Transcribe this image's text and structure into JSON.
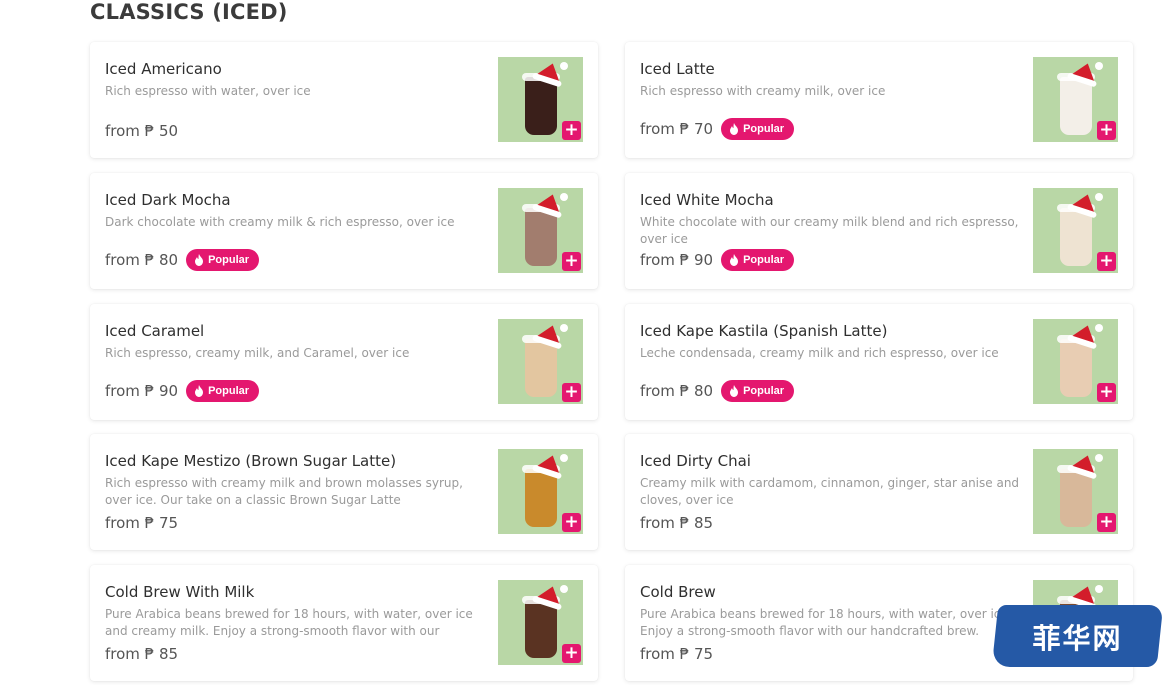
{
  "section": {
    "title": "CLASSICS (ICED)"
  },
  "popular_label": "Popular",
  "colors": {
    "accent": "#e4176f",
    "thumb_bg": "#b9d7a6"
  },
  "products": [
    {
      "name": "Iced Americano",
      "desc": "Rich espresso with water, over ice",
      "price": "from ₱ 50",
      "popular": false,
      "cup": "#3a1f1a"
    },
    {
      "name": "Iced Latte",
      "desc": "Rich espresso with creamy milk, over ice",
      "price": "from ₱ 70",
      "popular": true,
      "cup": "#f3efe8"
    },
    {
      "name": "Iced Dark Mocha",
      "desc": "Dark chocolate with creamy milk & rich espresso, over ice",
      "price": "from ₱ 80",
      "popular": true,
      "cup": "#a27d6e"
    },
    {
      "name": "Iced White Mocha",
      "desc": "White chocolate with our creamy milk blend and rich espresso, over ice",
      "price": "from ₱ 90",
      "popular": true,
      "cup": "#eee3d2"
    },
    {
      "name": "Iced Caramel",
      "desc": "Rich espresso, creamy milk, and Caramel, over ice",
      "price": "from ₱ 90",
      "popular": true,
      "cup": "#e3c6a0"
    },
    {
      "name": "Iced Kape Kastila (Spanish Latte)",
      "desc": "Leche condensada, creamy milk and rich espresso, over ice",
      "price": "from ₱ 80",
      "popular": true,
      "cup": "#e8cdb3"
    },
    {
      "name": "Iced Kape Mestizo (Brown Sugar Latte)",
      "desc": "Rich espresso with creamy milk and brown molasses syrup, over ice. Our take on a classic Brown Sugar Latte",
      "price": "from ₱ 75",
      "popular": false,
      "cup": "#c98a2c"
    },
    {
      "name": "Iced Dirty Chai",
      "desc": "Creamy milk with cardamom, cinnamon, ginger, star anise and cloves, over ice",
      "price": "from ₱ 85",
      "popular": false,
      "cup": "#d8b89a"
    },
    {
      "name": "Cold Brew With Milk",
      "desc": "Pure Arabica beans brewed for 18 hours, with water, over ice and creamy milk. Enjoy a strong-smooth flavor with our hand…",
      "price": "from ₱ 85",
      "popular": false,
      "cup": "#5a3322"
    },
    {
      "name": "Cold Brew",
      "desc": "Pure Arabica beans brewed for 18 hours, with water, over ice. Enjoy a strong-smooth flavor with our handcrafted brew.",
      "price": "from ₱ 75",
      "popular": false,
      "cup": "#7a4a2e"
    }
  ],
  "watermark": {
    "text": "菲华网"
  }
}
